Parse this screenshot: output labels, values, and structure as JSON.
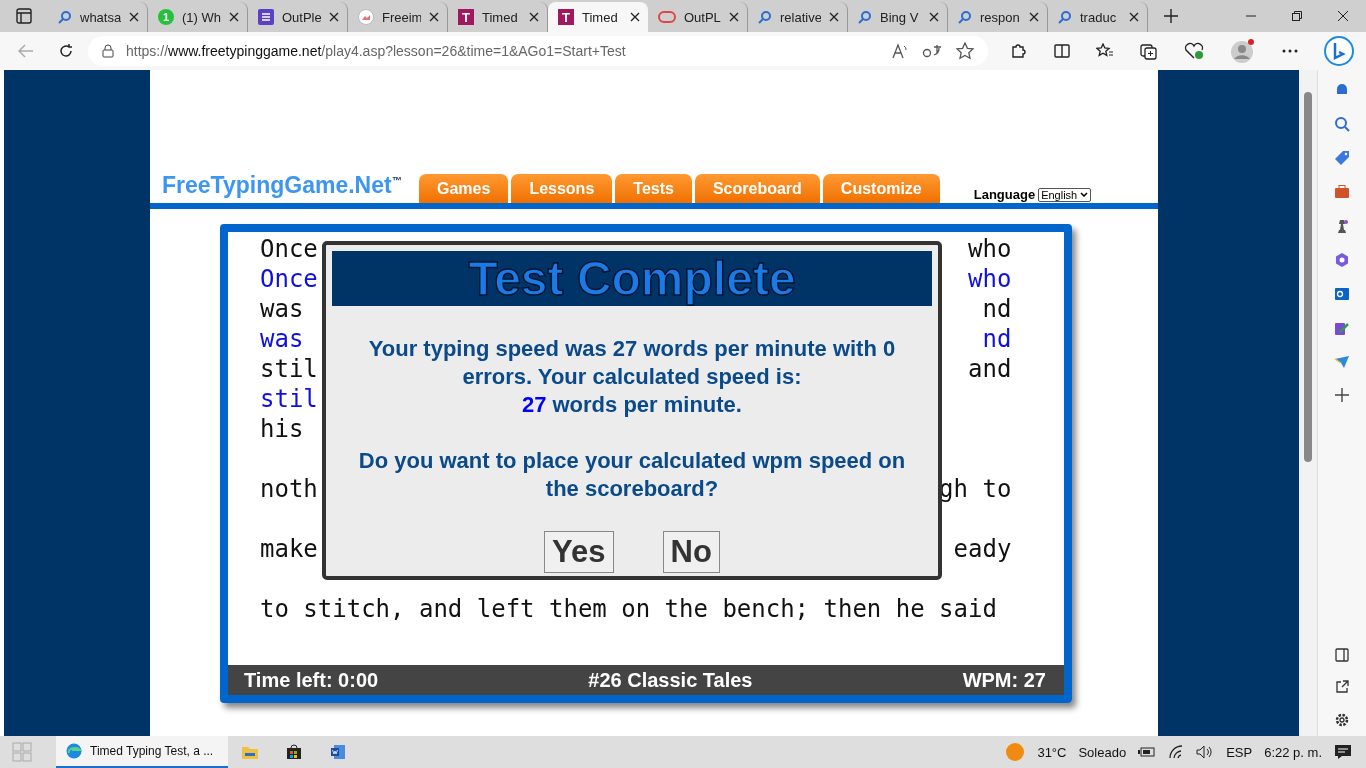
{
  "browser": {
    "tabs": [
      {
        "kind": "search",
        "title": "whatsa",
        "selected": false
      },
      {
        "kind": "whatsapp",
        "badge": "1",
        "title": "(1) Wh",
        "selected": false
      },
      {
        "kind": "list",
        "title": "OutPle",
        "selected": false
      },
      {
        "kind": "image",
        "title": "Freeim",
        "selected": false
      },
      {
        "kind": "letter",
        "letter": "T",
        "title": "Timed",
        "selected": false
      },
      {
        "kind": "letter",
        "letter": "T",
        "title": "Timed",
        "selected": true
      },
      {
        "kind": "oval",
        "title": "OutPL",
        "selected": false
      },
      {
        "kind": "search",
        "title": "relative",
        "selected": false
      },
      {
        "kind": "search",
        "title": "Bing V",
        "selected": false
      },
      {
        "kind": "search",
        "title": "respon",
        "selected": false
      },
      {
        "kind": "search",
        "title": "traduc",
        "selected": false
      }
    ],
    "url": {
      "scheme": "https://",
      "host": "www.freetypinggame.net",
      "path": "/play4.asp?lesson=26&time=1&AGo1=Start+Test"
    }
  },
  "page": {
    "logo": {
      "text": "FreeTypingGame.Net",
      "trademark": "™"
    },
    "nav": [
      "Games",
      "Lessons",
      "Tests",
      "Scoreboard",
      "Customize"
    ],
    "language": {
      "label": "Language",
      "value": "English"
    },
    "lines": [
      {
        "left": "Once",
        "right": "who",
        "typed": false
      },
      {
        "left": "Once",
        "right": "who",
        "typed": true
      },
      {
        "left": "was",
        "right": "nd",
        "typed": false
      },
      {
        "left": "was",
        "right": "nd",
        "typed": true
      },
      {
        "left": "stil",
        "right": "and",
        "typed": false
      },
      {
        "left": "stil",
        "typed": true
      },
      {
        "left": "his",
        "typed": false
      },
      {
        "left": "noth",
        "right": "gh to",
        "typed": false
      },
      {
        "left": "make",
        "right": "eady",
        "typed": false
      },
      {
        "left": "to stitch, and left them on the bench; then he said",
        "typed": false
      }
    ],
    "status": {
      "time_left": "Time left: 0:00",
      "lesson": "#26 Classic Tales",
      "wpm": "WPM: 27"
    }
  },
  "dialog": {
    "title": "Test Complete",
    "message": "Your typing speed was 27 words per minute with 0 errors. Your calculated speed is:",
    "speed": "27",
    "speed_unit": "words per minute.",
    "question": "Do you want to place your calculated wpm speed on the scoreboard?",
    "buttons": [
      "Yes",
      "No"
    ]
  },
  "taskbar": {
    "app": "Timed Typing Test, a ...",
    "temperature": "31°C",
    "weather": "Soleado",
    "language": "ESP",
    "time": "6:22 p. m."
  }
}
